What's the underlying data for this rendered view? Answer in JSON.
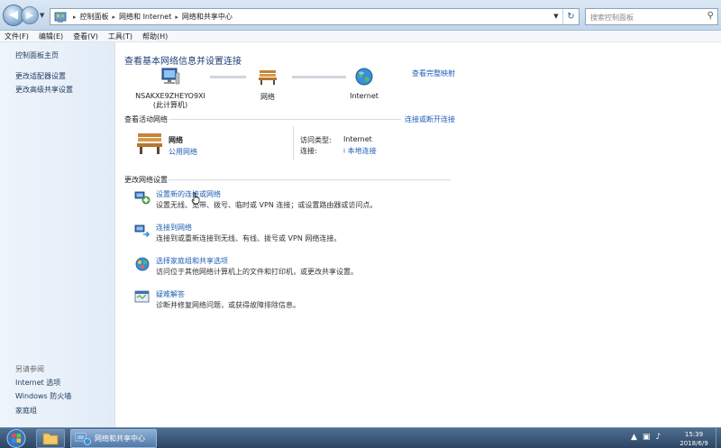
{
  "address_bar": {
    "breadcrumbs": [
      "控制面板",
      "网络和 Internet",
      "网络和共享中心"
    ],
    "search_placeholder": "搜索控制面板"
  },
  "menu": [
    "文件(F)",
    "编辑(E)",
    "查看(V)",
    "工具(T)",
    "帮助(H)"
  ],
  "left_panel": {
    "links": [
      "控制面板主页",
      "更改适配器设置",
      "更改高级共享设置"
    ],
    "see_also_label": "另请参阅",
    "see_also_links": [
      "Internet 选项",
      "Windows 防火墙",
      "家庭组"
    ]
  },
  "main": {
    "title": "查看基本网络信息并设置连接",
    "full_map_link": "查看完整映射",
    "map_nodes": [
      {
        "name": "NSAKXE9ZHEYO9XI",
        "sub": "(此计算机)"
      },
      {
        "name": "网络",
        "sub": ""
      },
      {
        "name": "Internet",
        "sub": ""
      }
    ],
    "active_networks_header": "查看活动网络",
    "connect_disconnect_link": "连接或断开连接",
    "active_network": {
      "name": "网络",
      "type": "公用网络",
      "access_label": "访问类型:",
      "access_value": "Internet",
      "conn_label": "连接:",
      "conn_value": "本地连接"
    },
    "change_settings_header": "更改网络设置",
    "tasks": [
      {
        "title": "设置新的连接或网络",
        "desc": "设置无线、宽带、拨号、临时或 VPN 连接；或设置路由器或访问点。"
      },
      {
        "title": "连接到网络",
        "desc": "连接到或重新连接到无线、有线、拨号或 VPN 网络连接。"
      },
      {
        "title": "选择家庭组和共享选项",
        "desc": "访问位于其他网络计算机上的文件和打印机，或更改共享设置。"
      },
      {
        "title": "疑难解答",
        "desc": "诊断并修复网络问题，或获得故障排除信息。"
      }
    ]
  },
  "taskbar": {
    "window_label": "网络和共享中心",
    "time": "15:39",
    "date": "2018/6/9"
  }
}
